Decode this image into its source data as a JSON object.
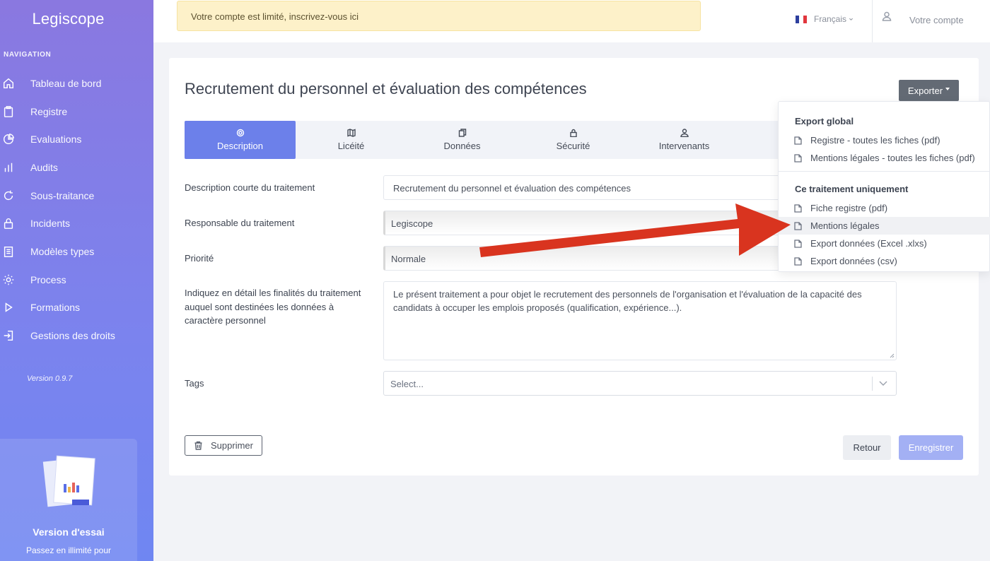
{
  "brand": "Legiscope",
  "nav": {
    "heading": "NAVIGATION",
    "items": [
      {
        "label": "Tableau de bord",
        "icon": "home-icon"
      },
      {
        "label": "Registre",
        "icon": "clipboard-icon"
      },
      {
        "label": "Evaluations",
        "icon": "pie-icon"
      },
      {
        "label": "Audits",
        "icon": "bar-chart-icon"
      },
      {
        "label": "Sous-traitance",
        "icon": "refresh-icon"
      },
      {
        "label": "Incidents",
        "icon": "lock-icon"
      },
      {
        "label": "Modèles types",
        "icon": "document-icon"
      },
      {
        "label": "Process",
        "icon": "gear-icon"
      },
      {
        "label": "Formations",
        "icon": "play-icon"
      },
      {
        "label": "Gestions des droits",
        "icon": "login-icon"
      }
    ],
    "version": "Version 0.9.7"
  },
  "trial": {
    "title": "Version d'essai",
    "text": "Passez en illimité pour"
  },
  "topbar": {
    "alert": "Votre compte est limité, inscrivez-vous ici",
    "language": "Français",
    "account": "Votre compte"
  },
  "page": {
    "title": "Recrutement du personnel et évaluation des compétences",
    "export_label": "Exporter"
  },
  "tabs": [
    {
      "label": "Description",
      "icon": "gear-icon",
      "active": true
    },
    {
      "label": "Licéité",
      "icon": "map-icon",
      "active": false
    },
    {
      "label": "Données",
      "icon": "copy-icon",
      "active": false
    },
    {
      "label": "Sécurité",
      "icon": "lock-icon",
      "active": false
    },
    {
      "label": "Intervenants",
      "icon": "user-icon",
      "active": false
    }
  ],
  "form": {
    "short_desc_label": "Description courte du traitement",
    "short_desc_value": "Recrutement du personnel et évaluation des compétences",
    "controller_label": "Responsable du traitement",
    "controller_value": "Legiscope",
    "priority_label": "Priorité",
    "priority_value": "Normale",
    "purposes_label": "Indiquez en détail les finalités du traitement auquel sont destinées les données à caractère personnel",
    "purposes_value": "Le présent traitement a pour objet le recrutement des personnels de l'organisation et l'évaluation de la capacité des candidats à occuper les emplois proposés (qualification, expérience...).",
    "tags_label": "Tags",
    "tags_placeholder": "Select..."
  },
  "actions": {
    "delete": "Supprimer",
    "back": "Retour",
    "save": "Enregistrer"
  },
  "export_menu": {
    "global_header": "Export global",
    "global_items": [
      "Registre - toutes les fiches (pdf)",
      "Mentions légales - toutes les fiches (pdf)"
    ],
    "single_header": "Ce traitement uniquement",
    "single_items": [
      "Fiche registre (pdf)",
      "Mentions légales",
      "Export données (Excel .xlxs)",
      "Export données (csv)"
    ],
    "hovered": "Mentions légales"
  },
  "colors": {
    "accent": "#6c80ea",
    "annotation_arrow": "#d9341f"
  }
}
